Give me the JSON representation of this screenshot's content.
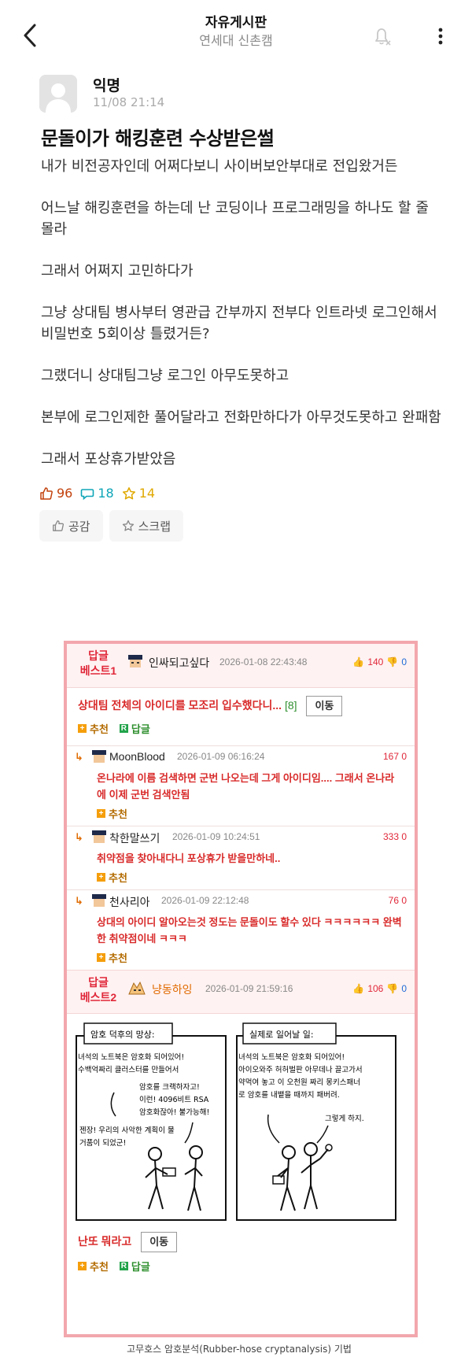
{
  "header": {
    "title": "자유게시판",
    "subtitle": "연세대 신촌캠"
  },
  "post": {
    "author": "익명",
    "date": "11/08 21:14",
    "title": "문돌이가 해킹훈련 수상받은썰",
    "paragraphs": [
      "내가 비전공자인데 어쩌다보니 사이버보안부대로 전입왔거든",
      "어느날 해킹훈련을 하는데 난 코딩이나 프로그래밍을 하나도 할 줄 몰라",
      "그래서 어쩌지 고민하다가",
      "그냥 상대팀 병사부터 영관급 간부까지 전부다 인트라넷 로그인해서 비밀번호 5회이상 틀렸거든?",
      "그랬더니 상대팀그냥 로그인 아무도못하고",
      "본부에 로그인제한 풀어달라고 전화만하다가 아무것도못하고 완패함",
      "그래서 포상휴가받았음"
    ],
    "likes": "96",
    "comments": "18",
    "scraps": "14",
    "like_button": "공감",
    "scrap_button": "스크랩"
  },
  "embed": {
    "best1": {
      "tag_line1": "답글",
      "tag_line2": "베스트1",
      "name": "인싸되고싶다",
      "time": "2026-01-08 22:43:48",
      "up": "140",
      "down": "0",
      "text": "상대팀 전체의 아이디를 모조리 입수했다니...",
      "count": "[8]",
      "move": "이동",
      "recommend": "추천",
      "reply": "답글"
    },
    "replies": [
      {
        "name": "MoonBlood",
        "time": "2026-01-09 06:16:24",
        "vote": "167 0",
        "text": "온나라에 이름 검색하면 군번 나오는데 그게 아이디임.... 그래서 온나라에 이제 군번 검색안됨",
        "recommend": "추천"
      },
      {
        "name": "착한말쓰기",
        "time": "2026-01-09 10:24:51",
        "vote": "333 0",
        "text": "취약점을 찾아내다니 포상휴가 받을만하네..",
        "recommend": "추천"
      },
      {
        "name": "천사리아",
        "time": "2026-01-09 22:12:48",
        "vote": "76 0",
        "text": "상대의 아이디 알아오는것 정도는 문돌이도 할수 있다 ㅋㅋㅋㅋㅋㅋ 완벽한 취약점이네 ㅋㅋㅋ",
        "recommend": "추천"
      }
    ],
    "best2": {
      "tag_line1": "답글",
      "tag_line2": "베스트2",
      "name": "냥동하잉",
      "time": "2026-01-09 21:59:16",
      "up": "106",
      "down": "0",
      "text": "난또 뭐라고",
      "move": "이동",
      "recommend": "추천",
      "reply": "답글"
    },
    "comic": {
      "left_title": "암호 덕후의 망상:",
      "left_lines": [
        "녀석의 노트북은 암호화 되어있어!",
        "수백억짜리 클러스터를 만들어서",
        "암호를 크랙하자고!",
        "이런! 4096비트 RSA",
        "암호화잖아! 불가능해!",
        "젠장! 우리의 사악한 계획이 물",
        "거품이 되었군!"
      ],
      "right_title": "실제로 일어날 일:",
      "right_lines": [
        "녀석의 노트북은 암호화 되어있어!",
        "아이오와주 허허벌판 아무데나 끌고가서",
        "약먹여 놓고 이 오천원 짜리 몽키스패너",
        "로 암호를 내뱉을 때까지 패버려.",
        "그렇게 하지."
      ]
    }
  },
  "caption": "고무호스 암호분석(Rubber-hose cryptanalysis) 기법"
}
